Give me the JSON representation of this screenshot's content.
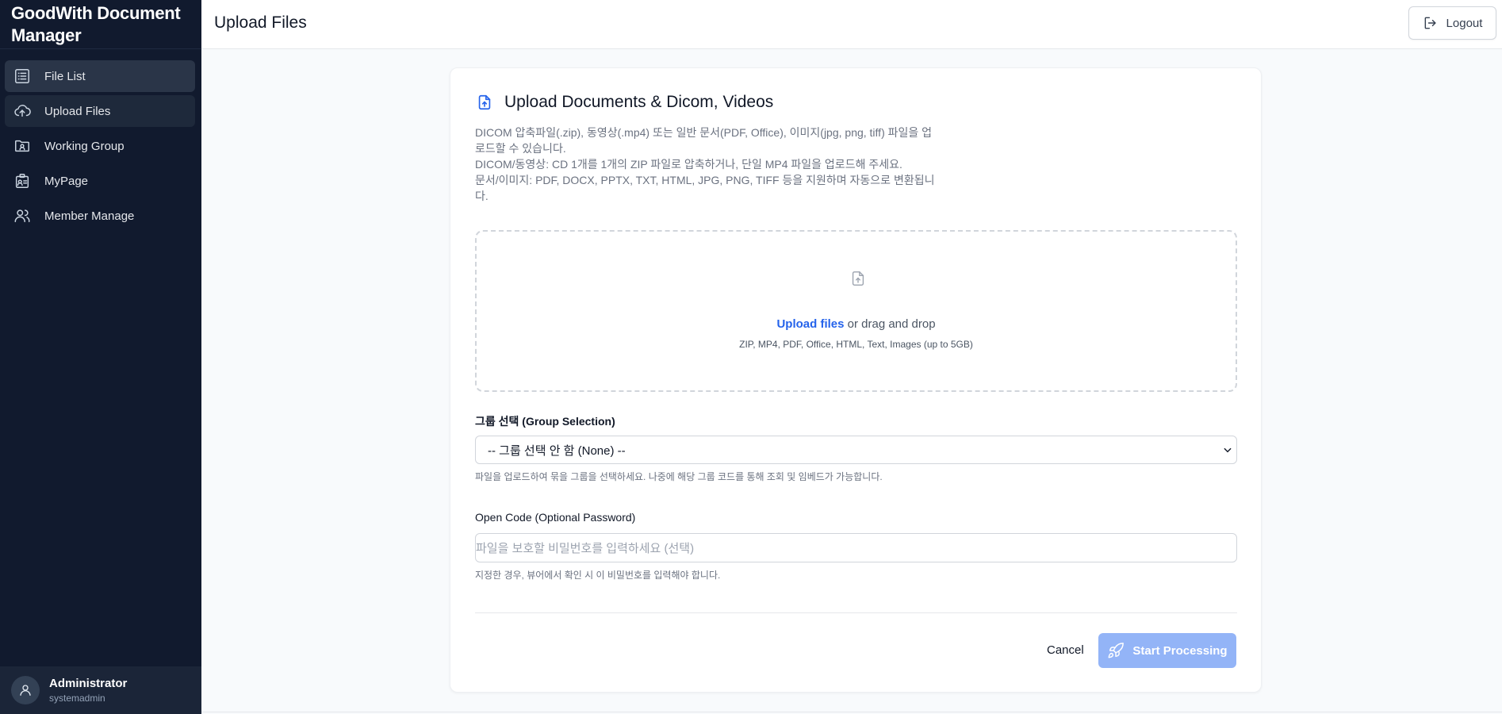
{
  "app": {
    "title": "GoodWith Document Manager"
  },
  "sidebar": {
    "items": [
      {
        "label": "File List",
        "icon": "list-icon"
      },
      {
        "label": "Upload Files",
        "icon": "cloud-upload-icon"
      },
      {
        "label": "Working Group",
        "icon": "folder-user-icon"
      },
      {
        "label": "MyPage",
        "icon": "badge-icon"
      },
      {
        "label": "Member Manage",
        "icon": "users-icon"
      }
    ]
  },
  "user": {
    "name": "Administrator",
    "id": "systemadmin"
  },
  "header": {
    "title": "Upload Files",
    "logout_label": "Logout"
  },
  "card": {
    "title": "Upload Documents & Dicom, Videos",
    "description": [
      "DICOM 압축파일(.zip), 동영상(.mp4) 또는 일반 문서(PDF, Office), 이미지(jpg, png, tiff) 파일을 업로드할 수 있습니다.",
      "DICOM/동영상: CD 1개를 1개의 ZIP 파일로 압축하거나, 단일 MP4 파일을 업로드해 주세요.",
      "문서/이미지: PDF, DOCX, PPTX, TXT, HTML, JPG, PNG, TIFF 등을 지원하며 자동으로 변환됩니다."
    ]
  },
  "dropzone": {
    "link_label": "Upload files",
    "text": " or drag and drop",
    "formats": "ZIP, MP4, PDF, Office, HTML, Text, Images (up to 5GB)"
  },
  "group": {
    "label": "그룹 선택 (Group Selection)",
    "selected": "-- 그룹 선택 안 함 (None) --",
    "help": "파일을 업로드하여 묶을 그룹을 선택하세요. 나중에 해당 그룹 코드를 통해 조회 및 임베드가 가능합니다."
  },
  "open_code": {
    "label": "Open Code (Optional Password)",
    "placeholder": "파일을 보호할 비밀번호를 입력하세요 (선택)",
    "help": "지정한 경우, 뷰어에서 확인 시 이 비밀번호를 입력해야 합니다."
  },
  "actions": {
    "cancel_label": "Cancel",
    "start_label": "Start Processing"
  },
  "colors": {
    "sidebar_bg": "#111a2e",
    "accent": "#2563eb",
    "start_disabled": "#93b4f7"
  }
}
